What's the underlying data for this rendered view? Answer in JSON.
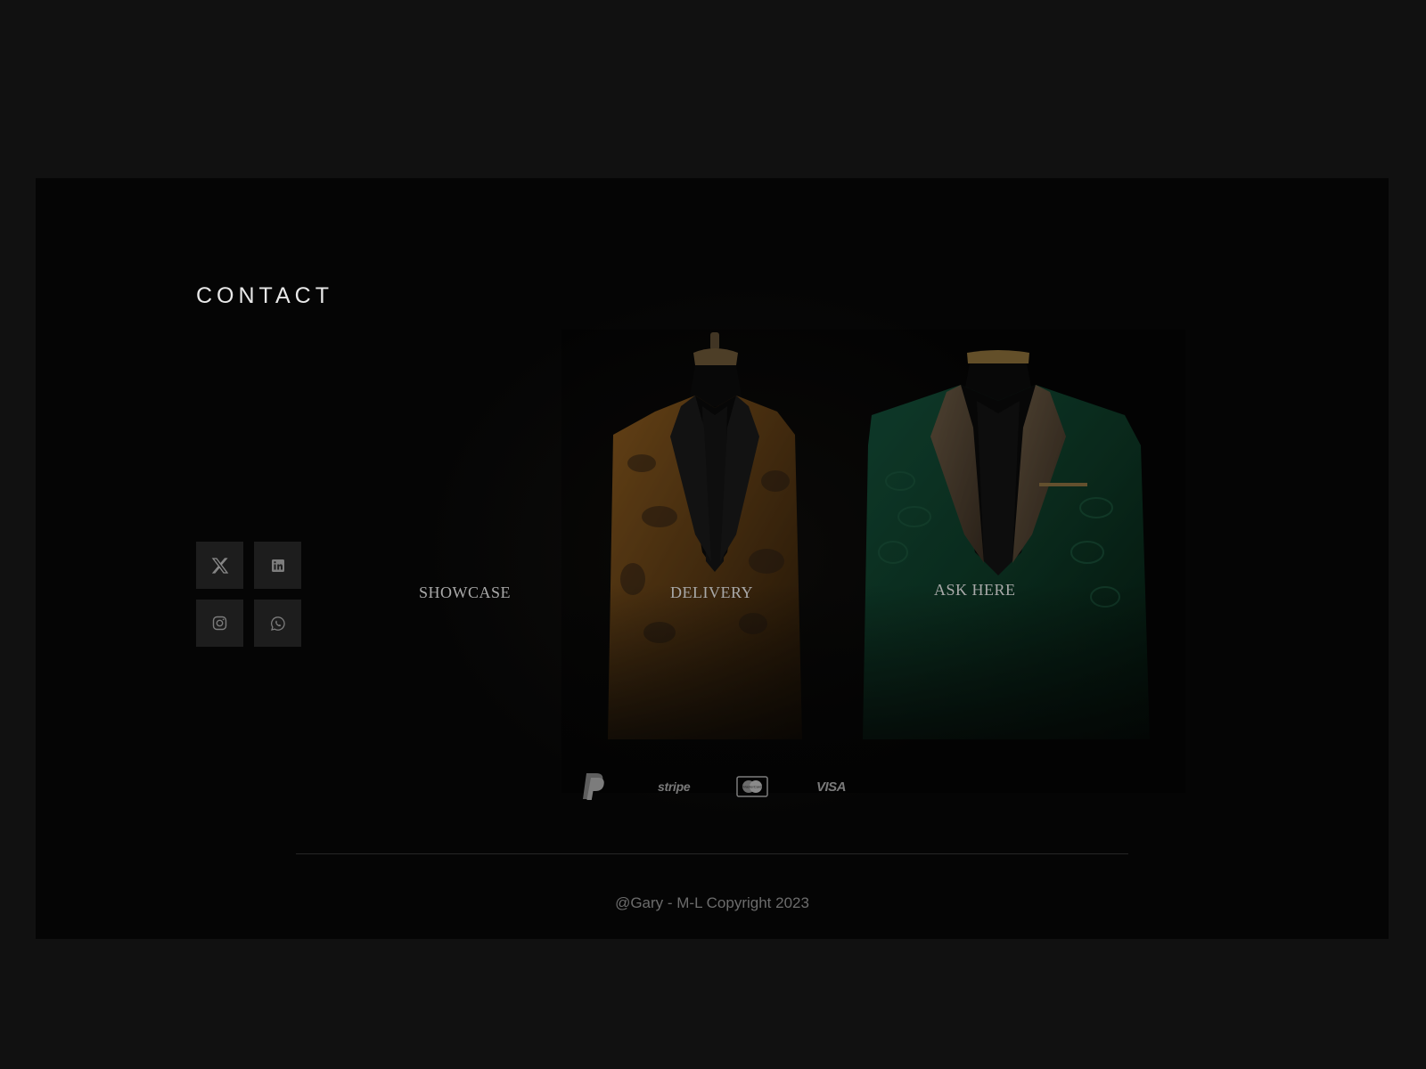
{
  "footer": {
    "title": "CONTACT",
    "nav": [
      {
        "label": "SHOWCASE"
      },
      {
        "label": "DELIVERY"
      },
      {
        "label": "ASK HERE"
      }
    ],
    "socials": [
      {
        "icon": "x-twitter-icon"
      },
      {
        "icon": "linkedin-icon"
      },
      {
        "icon": "instagram-icon"
      },
      {
        "icon": "whatsapp-icon"
      }
    ],
    "payments": [
      {
        "icon": "paypal-icon",
        "label": ""
      },
      {
        "icon": "stripe-icon",
        "label": "stripe"
      },
      {
        "icon": "mastercard-icon",
        "label": "MasterCard"
      },
      {
        "icon": "visa-icon",
        "label": "VISA"
      }
    ],
    "copyright": "@Gary - M-L Copyright 2023"
  },
  "colors": {
    "page_bg": "#111111",
    "panel_bg": "#050505",
    "tile_bg": "#1d1d1d",
    "text_light": "#e8e8e8",
    "text_muted": "#a9a9a9",
    "gold_suit": "#8a5a1e",
    "green_suit": "#0e3a27"
  }
}
